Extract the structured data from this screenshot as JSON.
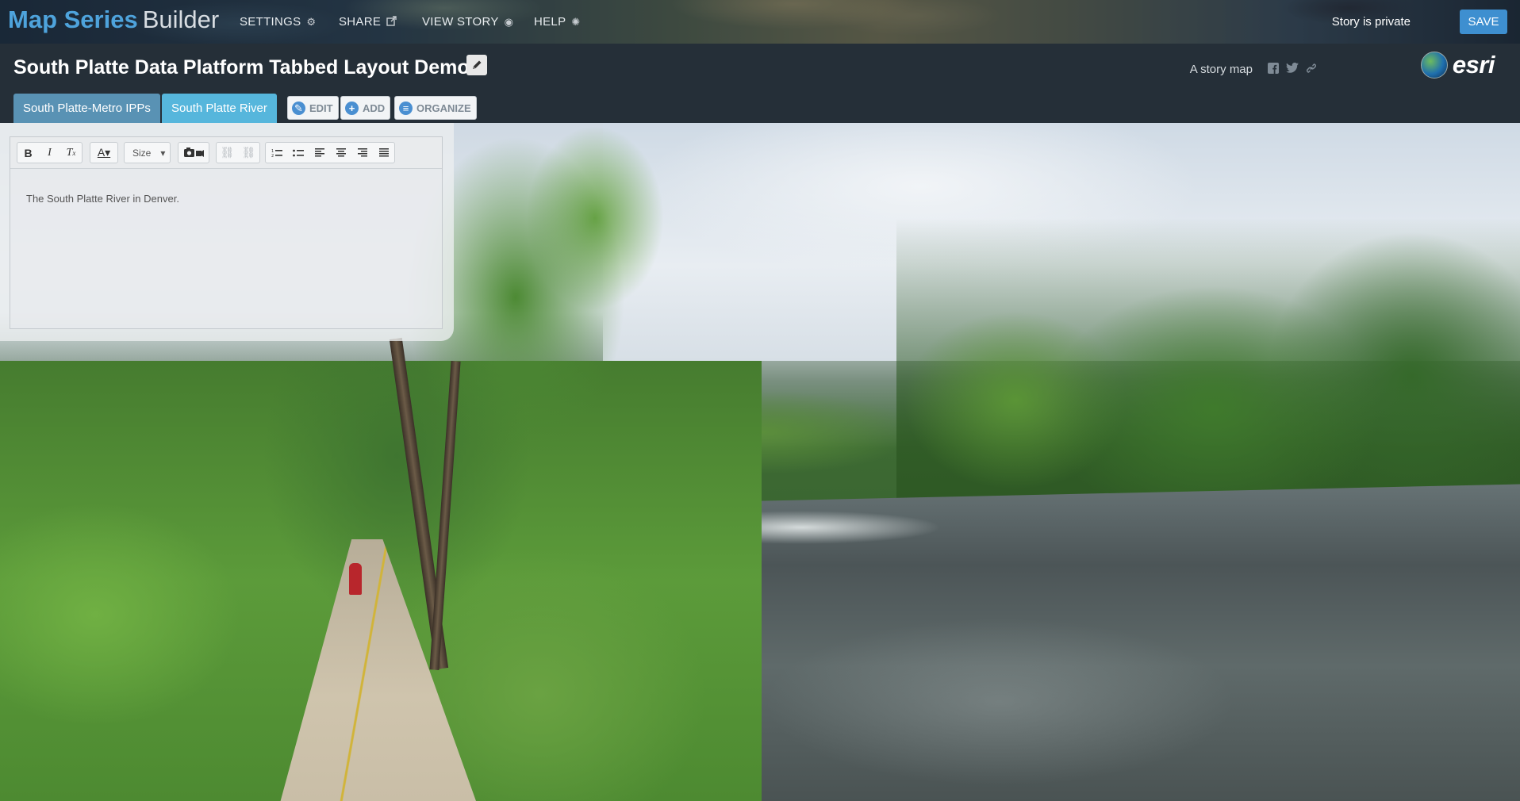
{
  "app": {
    "brand_primary": "Map Series",
    "brand_secondary": "Builder",
    "nav": [
      {
        "label": "SETTINGS",
        "icon": "gears-icon"
      },
      {
        "label": "SHARE",
        "icon": "share-icon"
      },
      {
        "label": "VIEW STORY",
        "icon": "eye-icon"
      },
      {
        "label": "HELP",
        "icon": "help-icon"
      }
    ],
    "privacy_status": "Story is private",
    "save_label": "SAVE"
  },
  "header": {
    "title": "South Platte Data Platform Tabbed Layout Demo",
    "story_map_label": "A story map",
    "esri_wordmark": "esri"
  },
  "tabs": [
    {
      "label": "South Platte-Metro IPPs",
      "active": false
    },
    {
      "label": "South Platte River",
      "active": true
    }
  ],
  "tab_actions": [
    {
      "label": "EDIT",
      "icon": "pencil-icon"
    },
    {
      "label": "ADD",
      "icon": "plus-icon"
    },
    {
      "label": "ORGANIZE",
      "icon": "list-icon"
    }
  ],
  "editor": {
    "size_label": "Size",
    "content": "The South Platte River in Denver."
  },
  "colors": {
    "brand_blue": "#4ea3dc",
    "save_button": "#3e8fd0",
    "tab_inactive": "#5992b4",
    "tab_active": "#56b6dc",
    "title_band": "#252f38"
  }
}
